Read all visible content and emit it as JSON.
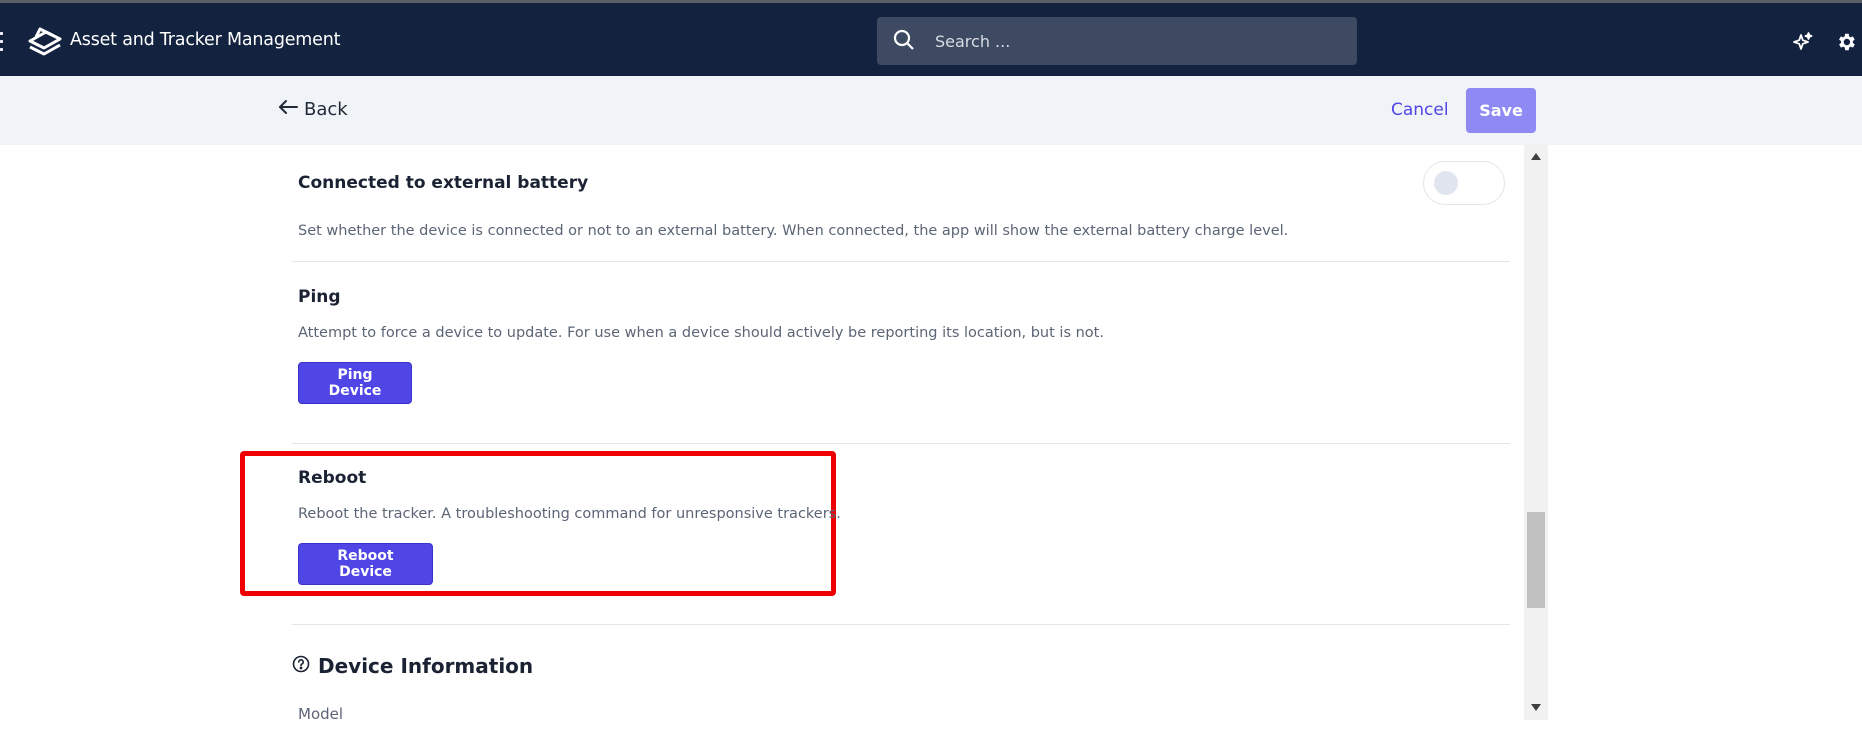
{
  "header": {
    "app_title": "Asset and Tracker Management",
    "search_placeholder": "Search ..."
  },
  "subbar": {
    "back_label": "Back",
    "cancel_label": "Cancel",
    "save_label": "Save"
  },
  "sections": {
    "external_battery": {
      "title": "Connected to external battery",
      "description": "Set whether the device is connected or not to an external battery. When connected, the app will show the external battery charge level.",
      "toggle_on": false
    },
    "ping": {
      "title": "Ping",
      "description": "Attempt to force a device to update. For use when a device should actively be reporting its location, but is not.",
      "button_label": "Ping Device"
    },
    "reboot": {
      "title": "Reboot",
      "description": "Reboot the tracker. A troubleshooting command for unresponsive trackers.",
      "button_label": "Reboot Device"
    },
    "device_information": {
      "title": "Device Information",
      "first_field_label": "Model"
    }
  },
  "colors": {
    "topbar": "#13233f",
    "accent": "#4f46e5",
    "save_disabled": "#8f89f4",
    "highlight": "#ee0000"
  },
  "icons": {
    "menu": "menu-dots-icon",
    "logo": "logo-icon",
    "search": "search-icon",
    "ai": "sparkle-icon",
    "settings": "gear-icon",
    "back": "arrow-left-icon",
    "help": "question-circle-icon"
  }
}
